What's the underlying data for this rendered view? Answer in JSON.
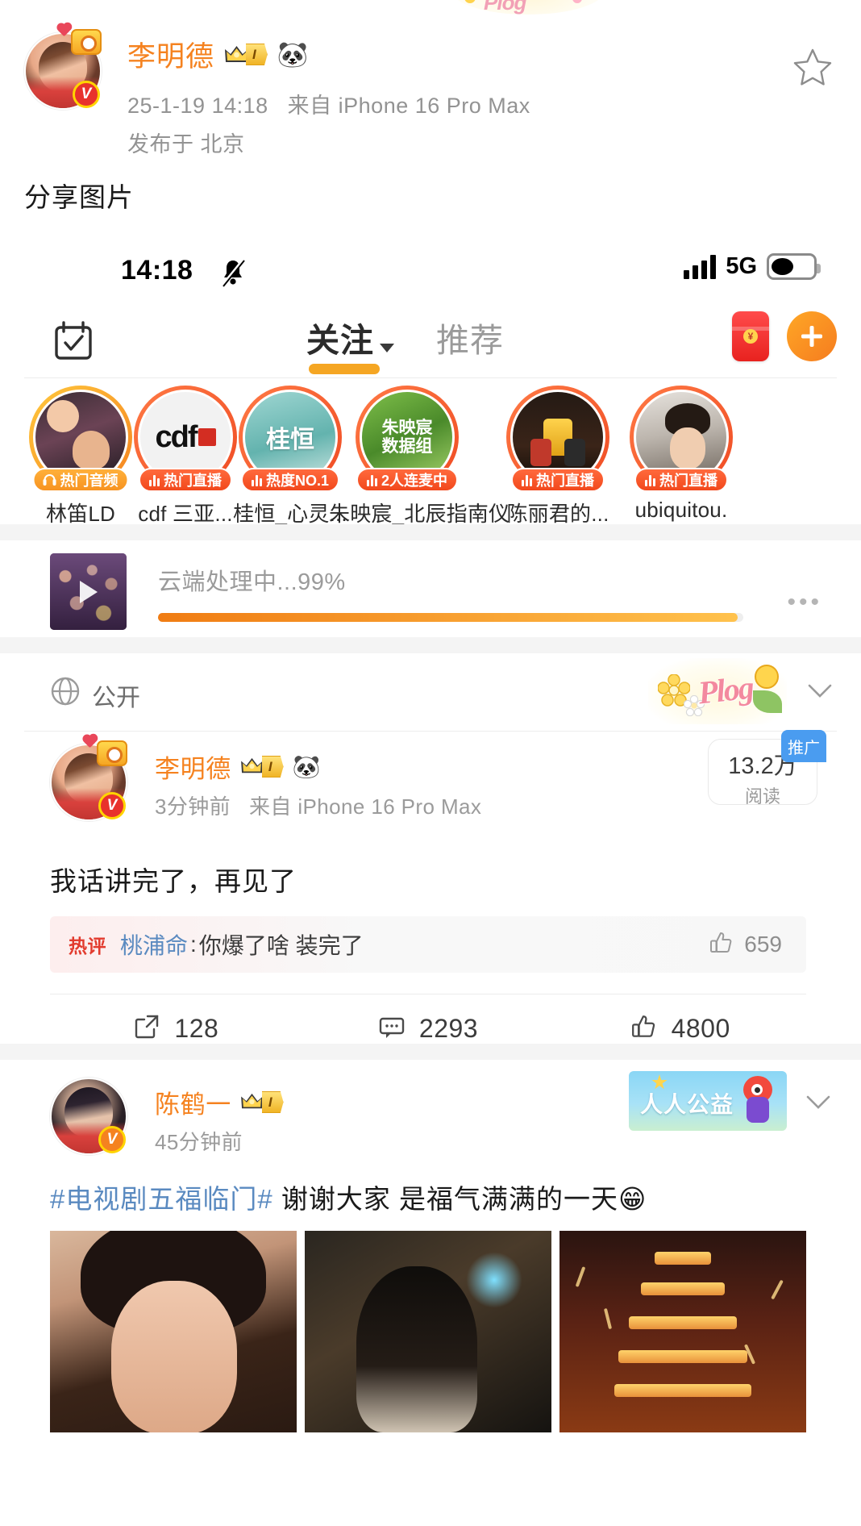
{
  "outer_post": {
    "author": "李明德",
    "level_badge": "I",
    "emoji": "🐼",
    "timestamp": "25-1-19 14:18",
    "source": "来自 iPhone 16 Pro Max",
    "location": "发布于 北京",
    "body": "分享图片",
    "star_icon": "star-outline-icon"
  },
  "screenshot": {
    "status_bar": {
      "time": "14:18",
      "mute_icon": "bell-slash-icon",
      "signal_icon": "signal-bars-icon",
      "network": "5G",
      "battery_icon": "battery-icon"
    },
    "nav": {
      "calendar_icon": "calendar-check-icon",
      "tabs": [
        {
          "label": "关注",
          "active": true,
          "has_caret": true
        },
        {
          "label": "推荐",
          "active": false,
          "has_caret": false
        }
      ],
      "gift_icon": "red-packet-icon",
      "compose_icon": "plus-icon"
    },
    "stories": [
      {
        "name": "林笛LD",
        "badge": "热门音频",
        "badge_type": "audio"
      },
      {
        "name": "cdf 三亚...",
        "badge": "热门直播",
        "badge_type": "live"
      },
      {
        "name": "桂恒_心灵...",
        "badge": "热度NO.1",
        "badge_type": "live"
      },
      {
        "name": "朱映宸_北辰指南仪",
        "badge": "2人连麦中",
        "badge_type": "live"
      },
      {
        "name": "陈丽君的...",
        "badge": "热门直播",
        "badge_type": "live"
      },
      {
        "name": "ubiquitou.",
        "badge": "热门直播",
        "badge_type": "live"
      }
    ],
    "upload": {
      "status_text": "云端处理中...99%",
      "progress_percent": 99,
      "more_icon": "ellipsis-icon",
      "play_icon": "play-icon"
    },
    "visibility": {
      "globe_icon": "globe-icon",
      "label": "公开",
      "sticker_label": "Plog",
      "collapse_icon": "chevron-down-icon"
    },
    "post_2": {
      "author": "李明德",
      "level_badge": "I",
      "emoji": "🐼",
      "timestamp": "3分钟前",
      "source": "来自 iPhone 16 Pro Max",
      "read_count": "13.2万",
      "read_label": "阅读",
      "promo_label": "推广",
      "body": "我话讲完了，再见了",
      "hot_comment": {
        "tag": "热评",
        "user": "桃浦命",
        "separator": ":",
        "text": "你爆了啥 装完了",
        "like_count": "659",
        "like_icon": "thumbs-up-icon"
      },
      "actions": [
        {
          "icon": "repost-icon",
          "count": "128"
        },
        {
          "icon": "comment-icon",
          "count": "2293"
        },
        {
          "icon": "thumbs-up-icon",
          "count": "4800"
        }
      ]
    },
    "post_3": {
      "author": "陈鹤一",
      "level_badge": "I",
      "timestamp": "45分钟前",
      "charity_badge": "人人公益",
      "collapse_icon": "chevron-down-icon",
      "hashtag": "#电视剧五福临门#",
      "body": " 谢谢大家 是福气满满的一天😁"
    }
  }
}
